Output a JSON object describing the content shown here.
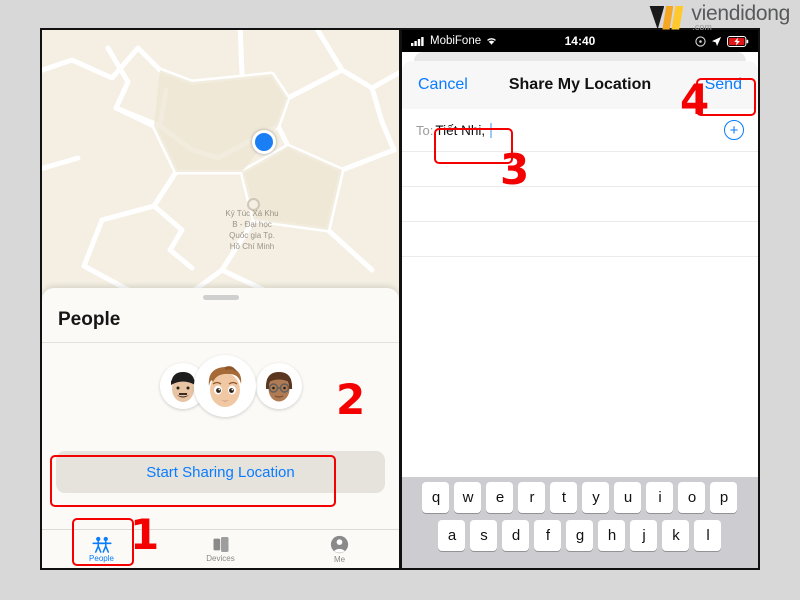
{
  "watermark": {
    "name": "viendidong",
    "suffix": ".com"
  },
  "left_phone": {
    "map": {
      "label_lines": [
        "Ký Túc Xá Khu",
        "B - Đại học",
        "Quốc gia Tp.",
        "Hồ Chí Minh"
      ],
      "user_dot": "current-location-dot"
    },
    "sheet": {
      "title": "People",
      "share_button_label": "Start Sharing Location",
      "avatars": [
        "memoji-man-dark-hair",
        "memoji-boy-brown-hair",
        "memoji-woman-glasses"
      ]
    },
    "tabs": [
      {
        "label": "People",
        "icon": "people-icon",
        "active": true
      },
      {
        "label": "Devices",
        "icon": "devices-icon",
        "active": false
      },
      {
        "label": "Me",
        "icon": "person-circle-icon",
        "active": false
      }
    ]
  },
  "right_phone": {
    "status_bar": {
      "carrier": "MobiFone",
      "signal": "signal-bars-icon",
      "wifi": "wifi-icon",
      "time": "14:40",
      "alarm": "alarm-icon",
      "location": "location-arrow-icon",
      "battery": "battery-charging-icon"
    },
    "modal": {
      "cancel_label": "Cancel",
      "title": "Share My Location",
      "send_label": "Send",
      "to_label": "To:",
      "to_value": "Tiết Nhi,",
      "add_contact_icon": "plus-circle-icon",
      "blank_rows": 3
    },
    "keyboard": {
      "row1": [
        "q",
        "w",
        "e",
        "r",
        "t",
        "y",
        "u",
        "i",
        "o",
        "p"
      ],
      "row2": [
        "a",
        "s",
        "d",
        "f",
        "g",
        "h",
        "j",
        "k",
        "l"
      ]
    }
  },
  "annotations": {
    "step1": "1",
    "step2": "2",
    "step3": "3",
    "step4": "4"
  },
  "colors": {
    "accent_blue": "#0a7cff",
    "annotation_red": "#f40000",
    "map_bg": "#f4efe2",
    "page_bg": "#d8d8d8"
  }
}
